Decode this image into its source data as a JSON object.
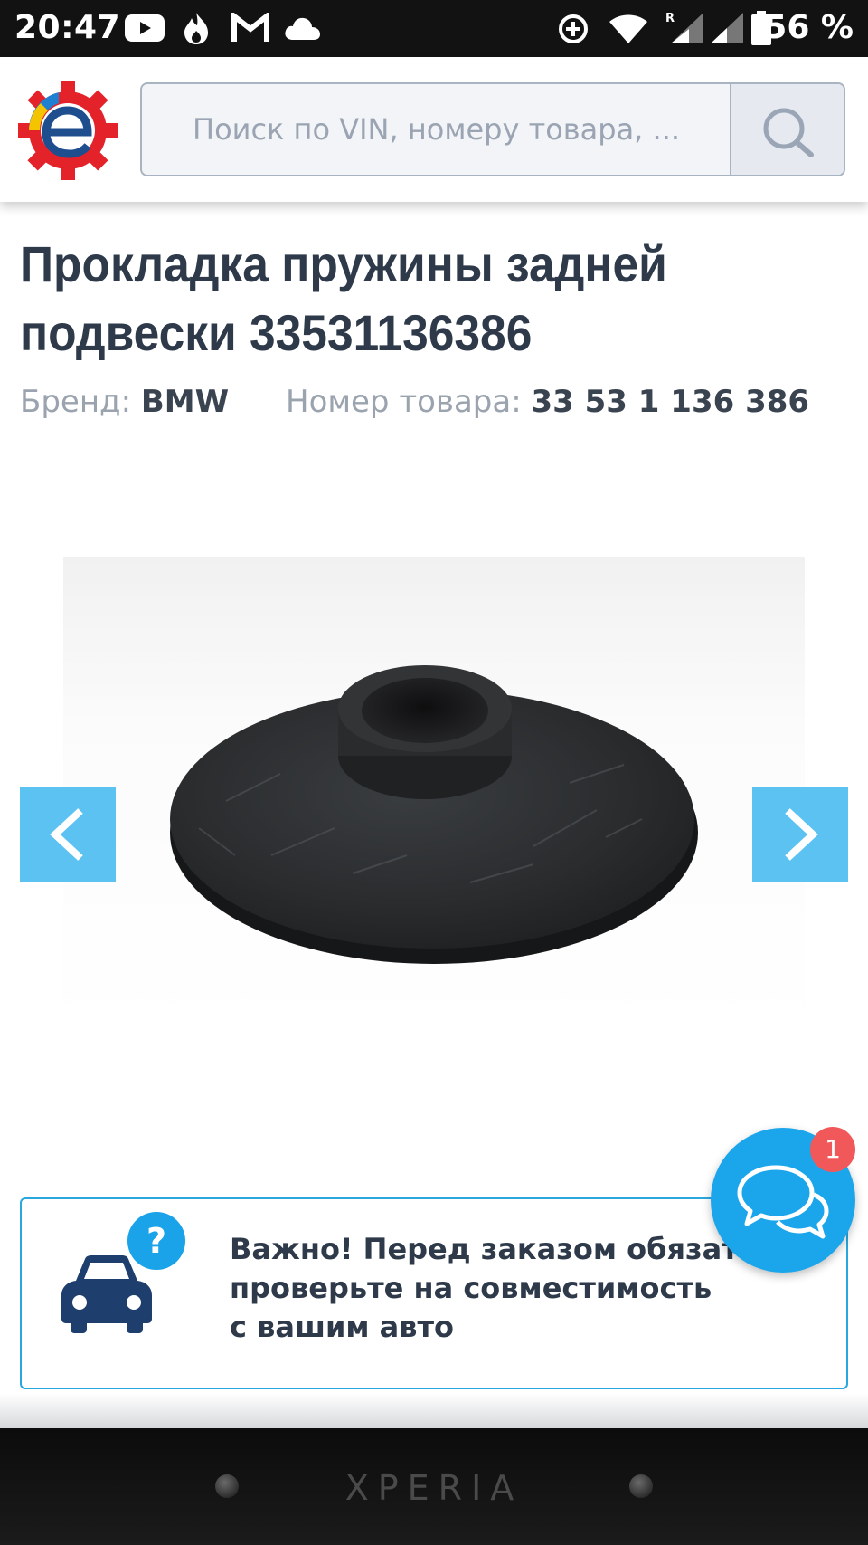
{
  "status_bar": {
    "time": "20:47",
    "battery": "56 %",
    "icons": [
      "youtube-icon",
      "fire-icon",
      "gmail-icon",
      "cloud-icon",
      "data-saver-icon",
      "wifi-icon",
      "signal-roaming-icon",
      "signal-icon",
      "battery-icon"
    ]
  },
  "header": {
    "logo": "e-logo",
    "search": {
      "placeholder": "Поиск по VIN, номеру товара, ...",
      "value": ""
    }
  },
  "product": {
    "title": "Прокладка пружины задней подвески 33531136386",
    "brand_label": "Бренд:",
    "brand_value": "BMW",
    "part_label": "Номер товара:",
    "part_value": "33 53 1 136 386"
  },
  "gallery": {
    "prev_icon": "chevron-left-icon",
    "next_icon": "chevron-right-icon",
    "image": "black rubber spring pad"
  },
  "notice": {
    "badge": "?",
    "lines": [
      "Важно! Перед заказом обязательно",
      "проверьте на совместимость",
      "с вашим авто"
    ]
  },
  "chat": {
    "badge_count": "1"
  },
  "device": {
    "brand": "XPERIA"
  },
  "colors": {
    "accent": "#5bc2f2",
    "chat": "#1ba6ec",
    "badge": "#f0585a",
    "title": "#2e3a4a",
    "notice_border": "#29a8e0"
  }
}
